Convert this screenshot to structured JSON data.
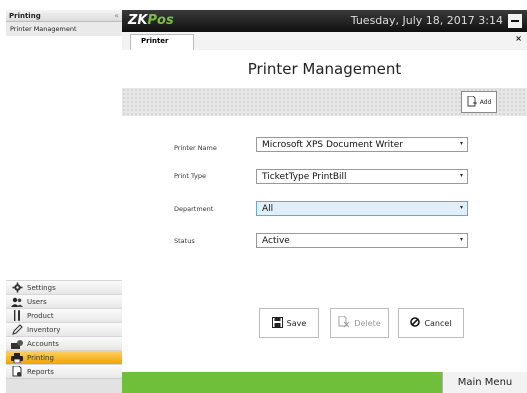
{
  "sidebar": {
    "title": "Printing",
    "collapse_icon": "«",
    "items": [
      {
        "label": "Printer Management"
      }
    ],
    "nav": [
      {
        "label": "Settings",
        "icon": "gear-icon"
      },
      {
        "label": "Users",
        "icon": "users-icon"
      },
      {
        "label": "Product",
        "icon": "fork-knife-icon"
      },
      {
        "label": "Inventory",
        "icon": "pencil-icon"
      },
      {
        "label": "Accounts",
        "icon": "money-icon"
      },
      {
        "label": "Printing",
        "icon": "printer-icon",
        "active": true
      },
      {
        "label": "Reports",
        "icon": "report-icon"
      }
    ]
  },
  "header": {
    "logo_zk": "ZK",
    "logo_pos": "Pos",
    "datetime": "Tuesday, July 18, 2017 3:14"
  },
  "tabs": [
    {
      "label": "Printer"
    }
  ],
  "tab_close": "×",
  "main": {
    "title": "Printer Management",
    "add_label": "Add",
    "form": {
      "printer_name_label": "Printer Name",
      "printer_name_value": "Microsoft XPS Document Writer",
      "print_type_label": "Print Type",
      "print_type_value": "TicketType PrintBill",
      "department_label": "Department",
      "department_value": "All",
      "status_label": "Status",
      "status_value": "Active"
    },
    "buttons": {
      "save": "Save",
      "delete": "Delete",
      "cancel": "Cancel"
    }
  },
  "footer": {
    "main_menu": "Main Menu"
  },
  "colors": {
    "accent_green": "#6fbf3b",
    "active_nav": "#f0a400",
    "header_dark": "#1a1a1a"
  }
}
